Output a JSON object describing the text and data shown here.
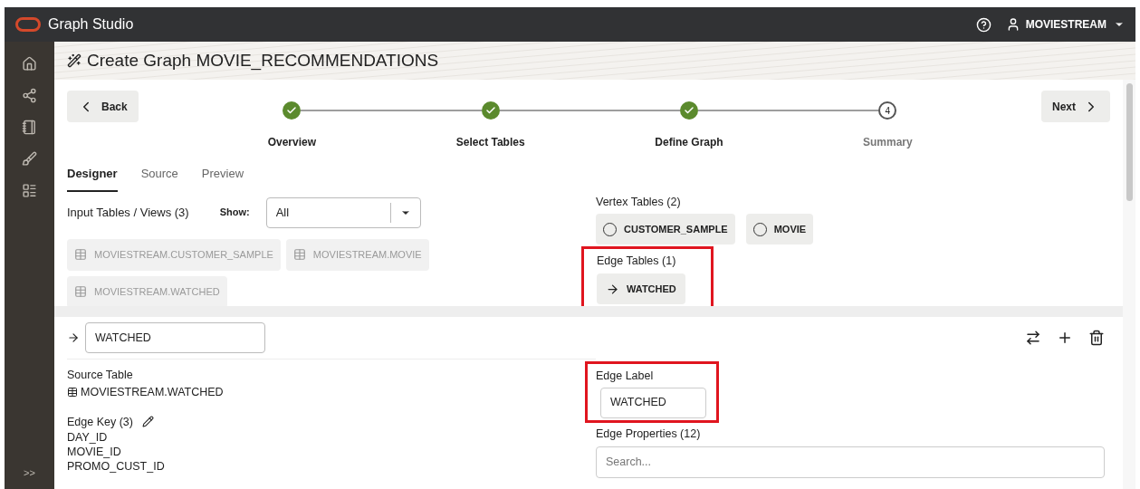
{
  "header": {
    "app_title": "Graph Studio",
    "user": "MOVIESTREAM"
  },
  "sidebar": {
    "collapse": ">>"
  },
  "page_title": "Create Graph MOVIE_RECOMMENDATIONS",
  "nav": {
    "back": "Back",
    "next": "Next"
  },
  "steps": [
    {
      "label": "Overview",
      "completed": true
    },
    {
      "label": "Select Tables",
      "completed": true
    },
    {
      "label": "Define Graph",
      "completed": true
    },
    {
      "label": "Summary",
      "number": "4",
      "completed": false
    }
  ],
  "tabs": [
    {
      "label": "Designer",
      "selected": true
    },
    {
      "label": "Source",
      "selected": false
    },
    {
      "label": "Preview",
      "selected": false
    }
  ],
  "input_tables": {
    "heading": "Input Tables / Views (3)",
    "show_label": "Show:",
    "show_value": "All",
    "items": [
      {
        "name": "MOVIESTREAM.CUSTOMER_SAMPLE",
        "disabled": true
      },
      {
        "name": "MOVIESTREAM.MOVIE",
        "disabled": true
      },
      {
        "name": "MOVIESTREAM.WATCHED",
        "disabled": true
      }
    ]
  },
  "vertex_tables": {
    "heading": "Vertex Tables (2)",
    "items": [
      "CUSTOMER_SAMPLE",
      "MOVIE"
    ]
  },
  "edge_tables": {
    "heading": "Edge Tables (1)",
    "highlighted": true,
    "items": [
      "WATCHED"
    ]
  },
  "edge_editor": {
    "name": "WATCHED",
    "source_heading": "Source Table",
    "source_table": "MOVIESTREAM.WATCHED",
    "key_heading": "Edge Key (3)",
    "keys": [
      "DAY_ID",
      "MOVIE_ID",
      "PROMO_CUST_ID"
    ],
    "label": {
      "heading": "Edge Label",
      "value": "WATCHED",
      "highlighted": true
    },
    "properties_heading": "Edge Properties (12)",
    "search_placeholder": "Search..."
  }
}
